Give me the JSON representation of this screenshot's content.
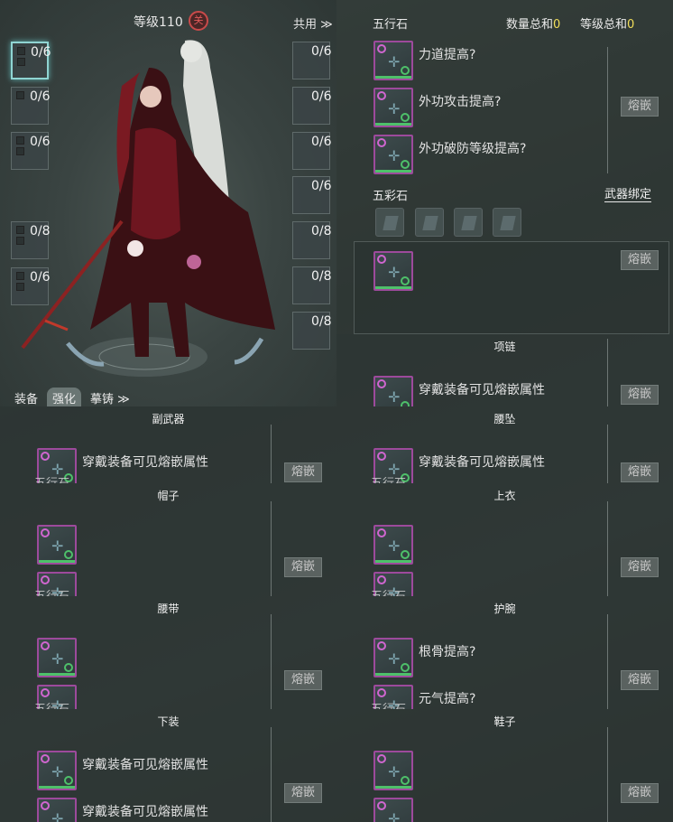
{
  "character": {
    "level_label": "等级110",
    "badge": "关",
    "shared_label": "共用 ≫",
    "left_slots": [
      "0/6",
      "0/6",
      "0/6",
      "0/8",
      "0/6"
    ],
    "right_slots": [
      "0/6",
      "0/6",
      "0/6",
      "0/6",
      "0/8",
      "0/8",
      "0/8"
    ],
    "tabs": [
      "装备",
      "强化",
      "摹铸 ≫"
    ]
  },
  "weapon": {
    "five_elements": "五行石",
    "count_label": "数量总和",
    "count_value": "0",
    "level_label": "等级总和",
    "level_value": "0",
    "attrs": [
      "力道提高?",
      "外功攻击提高?",
      "外功破防等级提高?"
    ],
    "inlay": "熔嵌",
    "color_stone": "五彩石",
    "bind_label": "武器绑定",
    "inlay2": "熔嵌"
  },
  "necklace": {
    "title": "项链",
    "attr": "穿戴装备可见熔嵌属性",
    "inlay": "熔嵌"
  },
  "cards": [
    {
      "title": "副武器",
      "attrs": [
        "穿戴装备可见熔嵌属性"
      ],
      "inlay": "熔嵌",
      "ghost": "五行石"
    },
    {
      "title": "腰坠",
      "attrs": [
        "穿戴装备可见熔嵌属性"
      ],
      "inlay": "熔嵌",
      "ghost": "五行石"
    },
    {
      "title": "帽子",
      "attrs": [],
      "inlay": "熔嵌",
      "ghost": "五行石"
    },
    {
      "title": "上衣",
      "attrs": [],
      "inlay": "熔嵌",
      "ghost": "五行石"
    },
    {
      "title": "腰带",
      "attrs": [],
      "inlay": "熔嵌",
      "ghost": "五行石"
    },
    {
      "title": "护腕",
      "attrs": [
        "根骨提高?",
        "元气提高?"
      ],
      "inlay": "熔嵌",
      "ghost": "五行石"
    },
    {
      "title": "下装",
      "attrs": [
        "穿戴装备可见熔嵌属性",
        "穿戴装备可见熔嵌属性"
      ],
      "inlay": "熔嵌",
      "ghost": ""
    },
    {
      "title": "鞋子",
      "attrs": [],
      "inlay": "熔嵌",
      "ghost": ""
    }
  ]
}
